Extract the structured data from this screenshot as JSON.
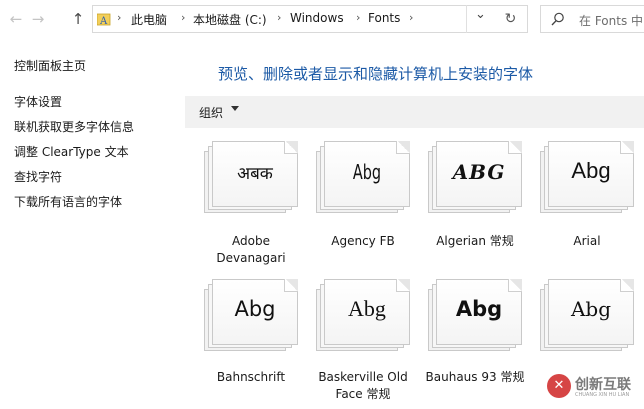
{
  "address_bar": {
    "breadcrumbs": [
      "此电脑",
      "本地磁盘 (C:)",
      "Windows",
      "Fonts"
    ],
    "separator": "›",
    "dropdown_glyph": "⌄",
    "refresh_glyph": "↻"
  },
  "nav": {
    "back_glyph": "←",
    "forward_glyph": "→",
    "up_glyph": "↑"
  },
  "search": {
    "placeholder": "在 Fonts 中"
  },
  "sidebar": {
    "items": [
      {
        "label": "控制面板主页"
      },
      {
        "label": "字体设置"
      },
      {
        "label": "联机获取更多字体信息"
      },
      {
        "label": "调整 ClearType 文本"
      },
      {
        "label": "查找字符"
      },
      {
        "label": "下载所有语言的字体"
      }
    ]
  },
  "main": {
    "title": "预览、删除或者显示和隐藏计算机上安装的字体",
    "organize_label": "组织"
  },
  "fonts": [
    {
      "name": "Adobe Devanagari",
      "sample": "अबक"
    },
    {
      "name": "Agency FB",
      "sample": "Abg"
    },
    {
      "name": "Algerian 常规",
      "sample": "ABG"
    },
    {
      "name": "Arial",
      "sample": "Abg"
    },
    {
      "name": "Bahnschrift",
      "sample": "Abg"
    },
    {
      "name": "Baskerville Old Face 常规",
      "sample": "Abg"
    },
    {
      "name": "Bauhaus 93 常规",
      "sample": "Abg"
    },
    {
      "name": "",
      "sample": "Abg"
    }
  ],
  "watermark": {
    "text": "创新互联",
    "sub": "CHUANG XIN HU LIAN",
    "logo": "✕"
  },
  "colors": {
    "title_blue": "#1c5aa6",
    "cmdbar_bg": "#f1f1f1",
    "watermark_red": "#d64545"
  }
}
